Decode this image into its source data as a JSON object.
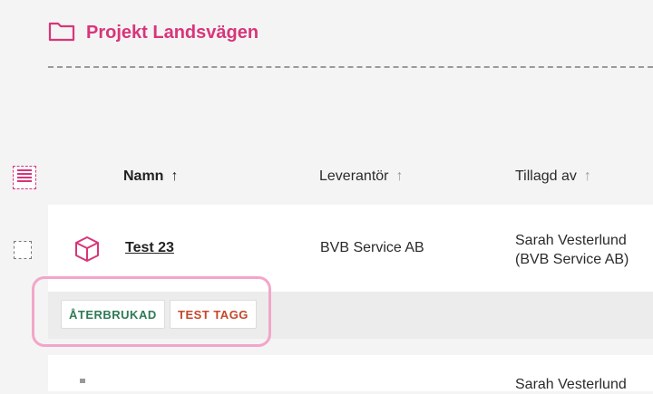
{
  "header": {
    "title": "Projekt Landsvägen",
    "folder_icon": "folder-icon"
  },
  "table": {
    "columns": [
      {
        "label": "Namn",
        "sort": "↑",
        "active": true
      },
      {
        "label": "Leverantör",
        "sort": "↑",
        "active": false
      },
      {
        "label": "Tillagd av",
        "sort": "↑",
        "active": false
      }
    ],
    "rows": [
      {
        "name": "Test 23",
        "supplier": "BVB Service AB",
        "added_by_line1": "Sarah Vesterlund",
        "added_by_line2": "(BVB Service AB)",
        "icon": "cube-icon",
        "tags": [
          {
            "label": "ÅTERBRUKAD",
            "color": "#2f7a55"
          },
          {
            "label": "TEST TAGG",
            "color": "#c4472b"
          }
        ]
      },
      {
        "added_by_line1": "Sarah Vesterlund"
      }
    ]
  },
  "colors": {
    "accent": "#d8357a",
    "highlight": "#f2a6c8"
  }
}
